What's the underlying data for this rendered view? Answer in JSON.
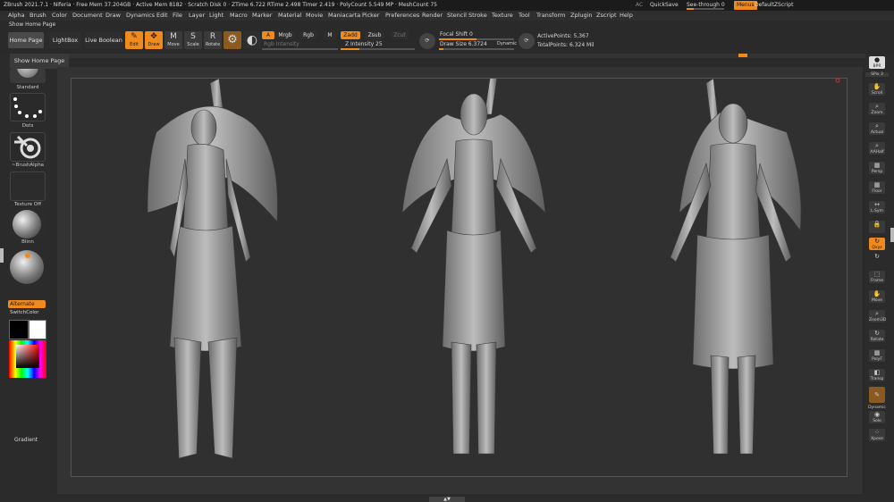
{
  "titlebar": {
    "stats": "ZBrush 2021.7.1 · Niferia · Free Mem 37.204GB · Active Mem 8182 · Scratch Disk 0 · ZTime 6.722 RTime 2.498 Timer 2.419 · PolyCount 5.549 MP · MeshCount 75",
    "ac": "AC",
    "quicksave": "QuickSave",
    "see_through": "See-through 0",
    "menus": "Menus",
    "default_script": "DefaultZScript"
  },
  "menu": [
    "Alpha",
    "Brush",
    "Color",
    "Document",
    "Draw",
    "Dynamics",
    "Edit",
    "File",
    "Layer",
    "Light",
    "Macro",
    "Marker",
    "Material",
    "Movie",
    "Maniacarta",
    "Picker",
    "Preferences",
    "Render",
    "Stencil",
    "Stroke",
    "Texture",
    "Tool",
    "Transform",
    "Zplugin",
    "Zscript",
    "Help"
  ],
  "home_page_label": "Show Home Page",
  "tooltip": "Show Home Page",
  "toolbar": {
    "home_page": "Home Page",
    "lightbox": "LightBox",
    "live_boolean": "Live Boolean",
    "edit": "Edit",
    "draw": "Draw",
    "move": "Move",
    "scale": "Scale",
    "rotate": "Rotate",
    "a": "A",
    "mrgb": "Mrgb",
    "rgb": "Rgb",
    "m": "M",
    "rgb_intensity": "Rgb Intensity",
    "zadd": "Zadd",
    "zsub": "Zsub",
    "zcut": "Zcut",
    "z_intensity": "Z Intensity 25",
    "focal_shift": "Focal Shift 0",
    "draw_size": "Draw Size 6.3724",
    "dynamic": "Dynamic",
    "active_points": "ActivePoints: 5,367",
    "total_points": "TotalPoints: 6.324 Mil"
  },
  "sliders": {
    "z_intensity": 0.25,
    "focal_shift": 0.5,
    "draw_size": 0.06
  },
  "left_panel": {
    "standard": "Standard",
    "dots": "Dots",
    "brush_alpha": "~BrushAlpha",
    "texture_off": "Texture Off",
    "blinn": "Blinn",
    "alternate": "Alternate",
    "switch_color": "SwitchColor",
    "gradient": "Gradient"
  },
  "right_panel": {
    "bpr": "BPR",
    "spix": "SPix 3",
    "scroll": "Scroll",
    "zoom": "Zoom",
    "actual": "Actual",
    "aahalf": "AAHalf",
    "persp": "Persp",
    "floor": "Floor",
    "lsym": "L.Sym",
    "xyz": "Qxyz",
    "frame": "Frame",
    "move": "Move",
    "zoom3d": "Zoom3D",
    "rotate": "Rotate",
    "polyf": "PolyF",
    "transp": "Transp",
    "dynamic": "Dynamic",
    "solo": "Solo",
    "xpose": "Xpose"
  },
  "colors": {
    "accent": "#f08a1c",
    "background": "#2a2a2a",
    "canvas": "#303030"
  },
  "icons": [
    "edit-icon",
    "draw-icon",
    "move-icon",
    "scale-icon",
    "rotate-icon",
    "gear-icon",
    "sphere-icon"
  ]
}
